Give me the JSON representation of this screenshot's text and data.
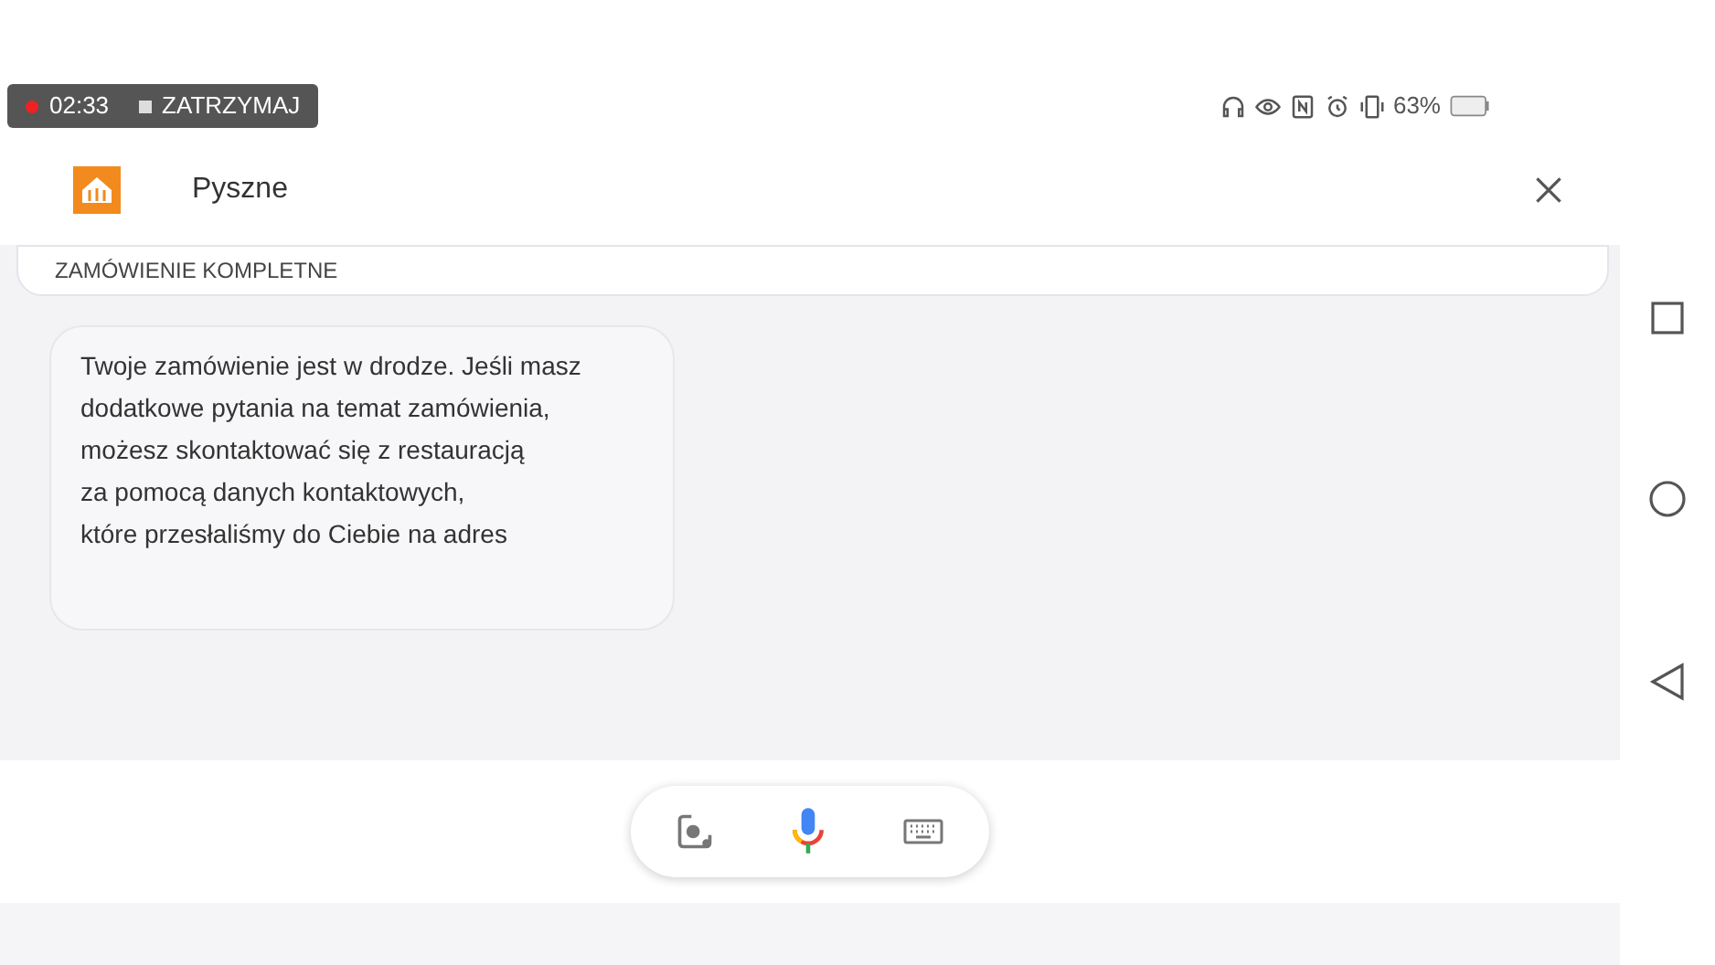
{
  "recording": {
    "time": "02:33",
    "stop_label": "ZATRZYMAJ"
  },
  "status_bar": {
    "battery": "63%"
  },
  "header": {
    "title": "Pyszne"
  },
  "messages": [
    {
      "kind": "card",
      "text": "ZAMÓWIENIE KOMPLETNE"
    },
    {
      "kind": "bubble",
      "lines": [
        "Twoje zamówienie jest w drodze. Jeśli masz",
        "dodatkowe pytania na temat zamówienia,",
        "możesz skontaktować się z restauracją",
        "za pomocą danych kontaktowych,",
        "które przesłaliśmy do Ciebie na adres"
      ]
    }
  ]
}
